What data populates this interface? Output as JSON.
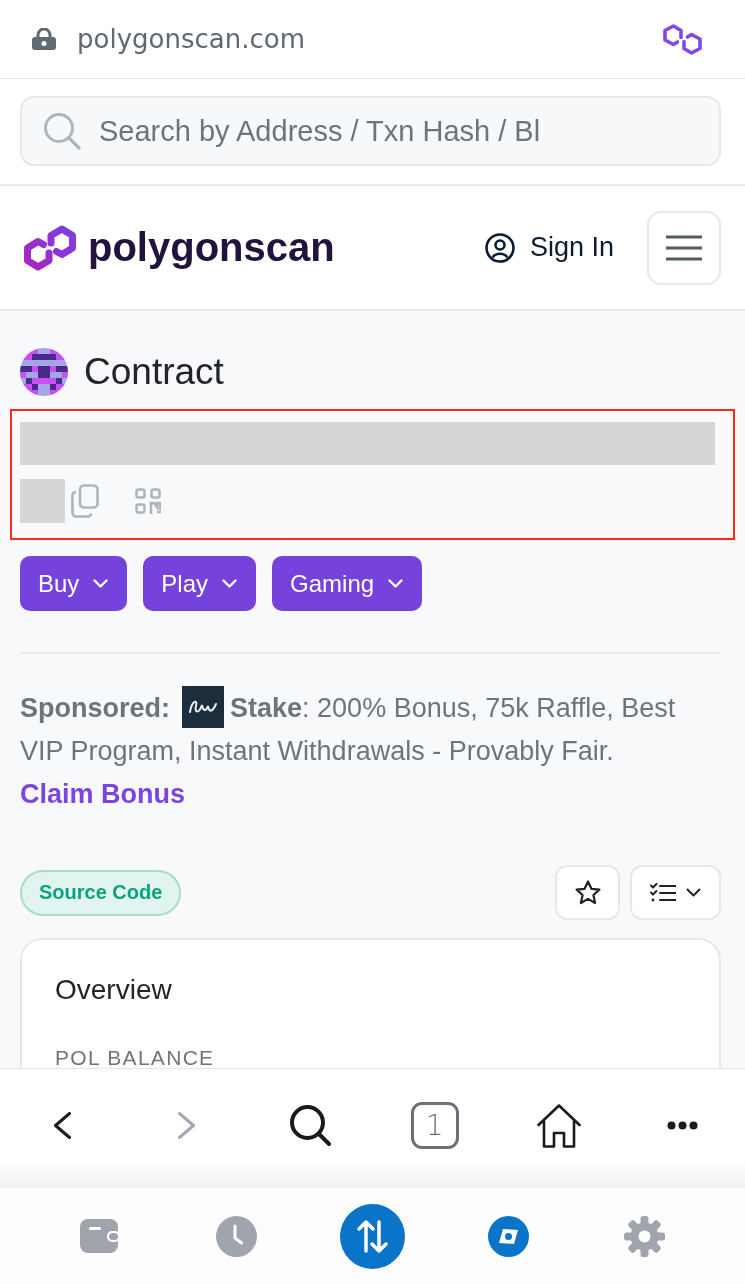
{
  "browser_bar": {
    "url": "polygonscan.com"
  },
  "search": {
    "placeholder": "Search by Address / Txn Hash / Bl"
  },
  "header": {
    "brand": "polygonscan",
    "sign_in": "Sign In"
  },
  "contract": {
    "title": "Contract"
  },
  "action_buttons": [
    {
      "label": "Buy"
    },
    {
      "label": "Play"
    },
    {
      "label": "Gaming"
    }
  ],
  "sponsored": {
    "label": "Sponsored:",
    "text": "**Stake**: 200% Bonus, 75k Raffle, Best VIP Program, Instant Withdrawals - Provably Fair.",
    "link": "Claim Bonus"
  },
  "badge": {
    "label": "Source Code"
  },
  "overview": {
    "title": "Overview",
    "field_label": "POL BALANCE"
  },
  "browser_toolbar": [
    {
      "kind": "back",
      "disabled": false
    },
    {
      "kind": "forward",
      "disabled": true
    },
    {
      "kind": "search",
      "disabled": false
    },
    {
      "kind": "tabs",
      "label": "1",
      "disabled": false
    },
    {
      "kind": "home",
      "disabled": false
    },
    {
      "kind": "more",
      "disabled": false
    }
  ],
  "bottom_nav": [
    {
      "kind": "wallet",
      "selected": false
    },
    {
      "kind": "history",
      "selected": false
    },
    {
      "kind": "swap",
      "selected": false
    },
    {
      "kind": "explore",
      "selected": true
    },
    {
      "kind": "settings",
      "selected": false
    }
  ]
}
